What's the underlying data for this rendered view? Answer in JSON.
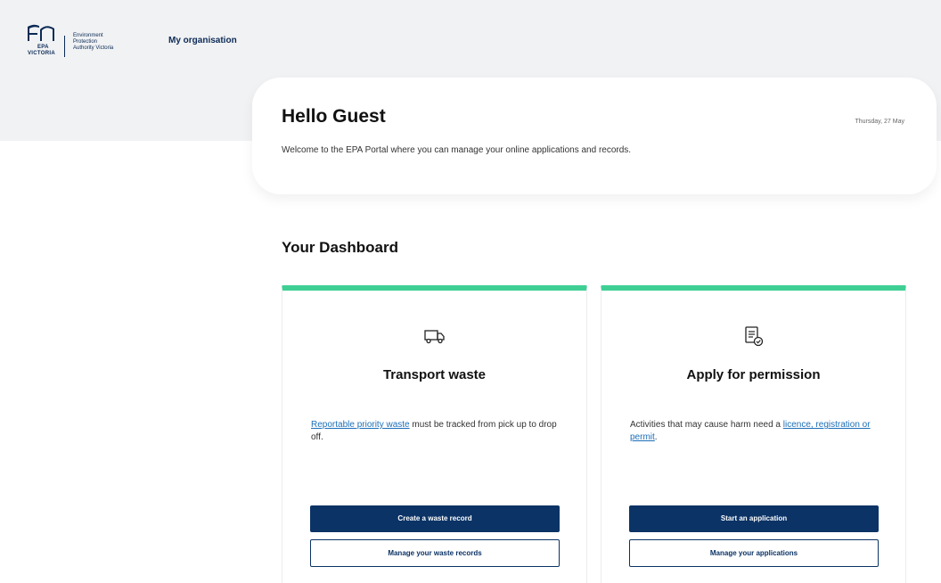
{
  "header": {
    "logo": {
      "abbr": "EPA",
      "state": "VICTORIA",
      "org_line1": "Environment",
      "org_line2": "Protection",
      "org_line3": "Authority Victoria"
    },
    "nav_my_organisation": "My organisation"
  },
  "welcome": {
    "title": "Hello Guest",
    "date": "Thursday, 27 May",
    "text": "Welcome to the EPA Portal where you can manage your online applications and records."
  },
  "dashboard": {
    "title": "Your Dashboard",
    "cards": [
      {
        "icon": "truck-icon",
        "title": "Transport waste",
        "link_text": "Reportable priority waste",
        "text_after": " must be tracked from pick up to drop off.",
        "primary_button": "Create a waste record",
        "secondary_button": "Manage your waste records"
      },
      {
        "icon": "document-check-icon",
        "title": "Apply for permission",
        "text_before": "Activities that may cause harm need a ",
        "link_text": "licence, registration or permit",
        "text_after": ".",
        "primary_button": "Start an application",
        "secondary_button": "Manage your applications"
      }
    ]
  },
  "colors": {
    "primary": "#0b3366",
    "accent": "#3fcf95",
    "link": "#1d6fb8",
    "band": "#f1f2f4"
  }
}
